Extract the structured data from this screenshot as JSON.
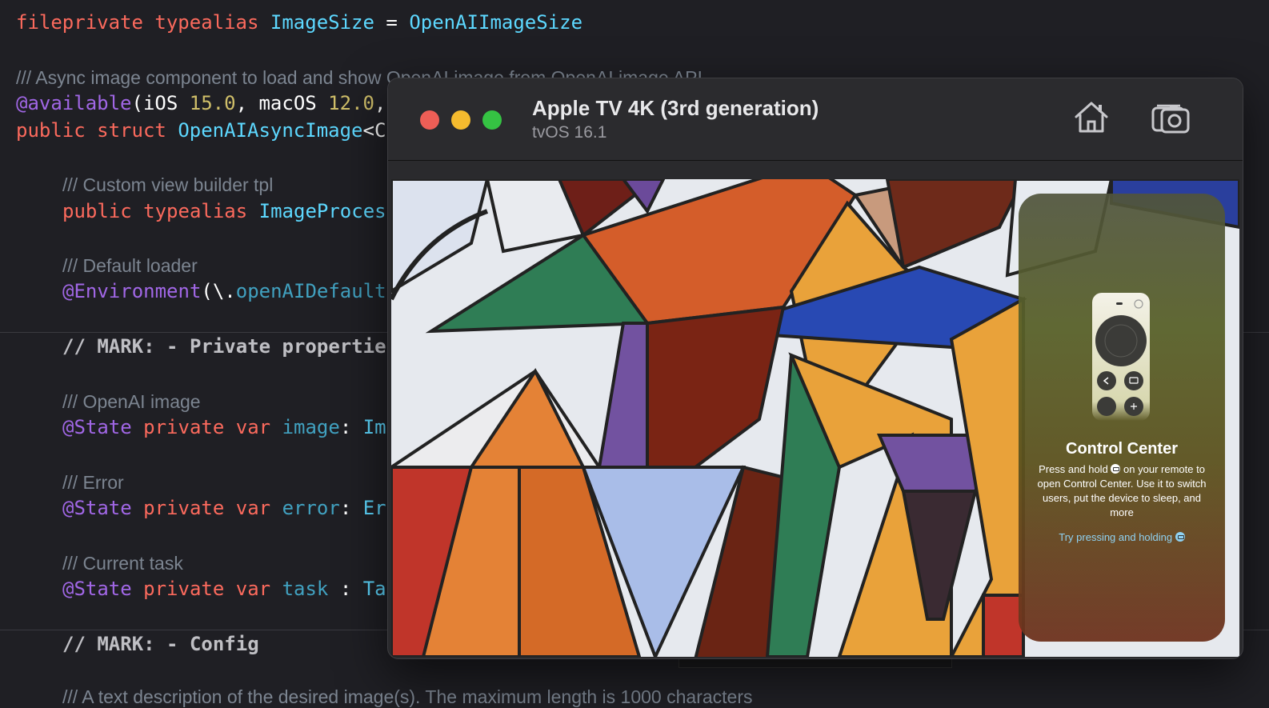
{
  "editor": {
    "line1": {
      "kw1": "fileprivate",
      "kw2": "typealias",
      "name": "ImageSize",
      "eq": " = ",
      "type": "OpenAIImageSize"
    },
    "line2_doc": "/// Async image component to load and show OpenAI image from OpenAI image API",
    "line3": {
      "attr": "@available",
      "open": "(",
      "p1": "iOS",
      "v1": "15.0",
      "comma1": ", ",
      "p2": "macOS",
      "v2": "12.0",
      "rest": ","
    },
    "line4": {
      "kw1": "public",
      "kw2": "struct",
      "name": "OpenAIAsyncImage",
      "rest": "<C"
    },
    "line5_doc": "/// Custom view builder tpl",
    "line6": {
      "kw1": "public",
      "kw2": "typealias",
      "name": "ImageProces"
    },
    "line7_doc": "/// Default loader",
    "line8": {
      "attr": "@Environment",
      "rest": "(\\.",
      "prop": "openAIDefault"
    },
    "line9_mark": "// MARK: - Private propertie",
    "line10_doc": "/// OpenAI image",
    "line11": {
      "attr": "@State",
      "kw1": "private",
      "kw2": "var",
      "name": "image",
      "colon": ": ",
      "type": "Im"
    },
    "line12_doc": "/// Error",
    "line13": {
      "attr": "@State",
      "kw1": "private",
      "kw2": "var",
      "name": "error",
      "colon": ": ",
      "type": "Er"
    },
    "line14_doc": "/// Current task",
    "line15": {
      "attr": "@State",
      "kw1": "private",
      "kw2": "var",
      "name": "task",
      "colon": " : ",
      "type": "Ta"
    },
    "line16_mark": "// MARK: - Config",
    "line17_doc": "/// A text description of the desired image(s). The maximum length is 1000 characters"
  },
  "simulator": {
    "title": "Apple TV 4K (3rd generation)",
    "subtitle": "tvOS 16.1",
    "home_icon": "home-icon",
    "screenshot_icon": "camera-icon"
  },
  "control_center": {
    "title": "Control Center",
    "body_before": "Press and hold ",
    "body_after": " on your remote to open Control Center. Use it to switch users, put the device to sleep, and more",
    "link": "Try pressing and holding "
  },
  "colors": {
    "keyword": "#fc6a5d",
    "type": "#5dd8ff",
    "attribute": "#a167e6",
    "number": "#d0bf69",
    "comment": "#7c8591",
    "background": "#1f1f24"
  }
}
